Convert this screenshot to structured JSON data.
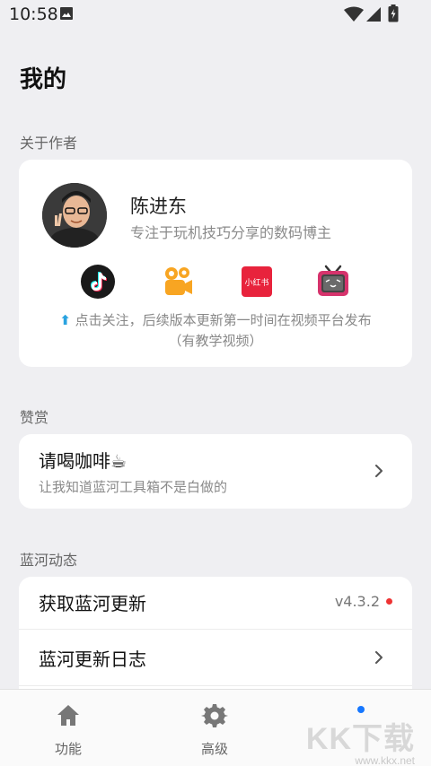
{
  "status_bar": {
    "time": "10:58"
  },
  "page": {
    "title": "我的"
  },
  "about_author": {
    "section_label": "关于作者",
    "name": "陈进东",
    "description": "专注于玩机技巧分享的数码博主",
    "social_icons": [
      "douyin-icon",
      "kuaishou-icon",
      "xiaohongshu-icon",
      "bilibili-icon"
    ],
    "xiaohongshu_label": "小红书",
    "follow_arrow": "⬆",
    "follow_text": "点击关注，后续版本更新第一时间在视频平台发布",
    "follow_sub": "（有教学视频）"
  },
  "appreciate": {
    "section_label": "赞赏",
    "title": "请喝咖啡☕",
    "subtitle": "让我知道蓝河工具箱不是白做的"
  },
  "lanhe_news": {
    "section_label": "蓝河动态",
    "items": [
      {
        "label": "获取蓝河更新",
        "version": "v4.3.2"
      },
      {
        "label": "蓝河更新日志"
      }
    ]
  },
  "bottom_nav": {
    "items": [
      {
        "label": "功能",
        "icon": "home-icon"
      },
      {
        "label": "高级",
        "icon": "gear-icon"
      },
      {
        "label": "",
        "icon": "notification-dot"
      }
    ]
  },
  "watermark": {
    "text": "KK下载",
    "url": "www.kkx.net"
  },
  "colors": {
    "accent": "#1677ff",
    "red_dot": "#e33333",
    "background": "#efeff2"
  }
}
